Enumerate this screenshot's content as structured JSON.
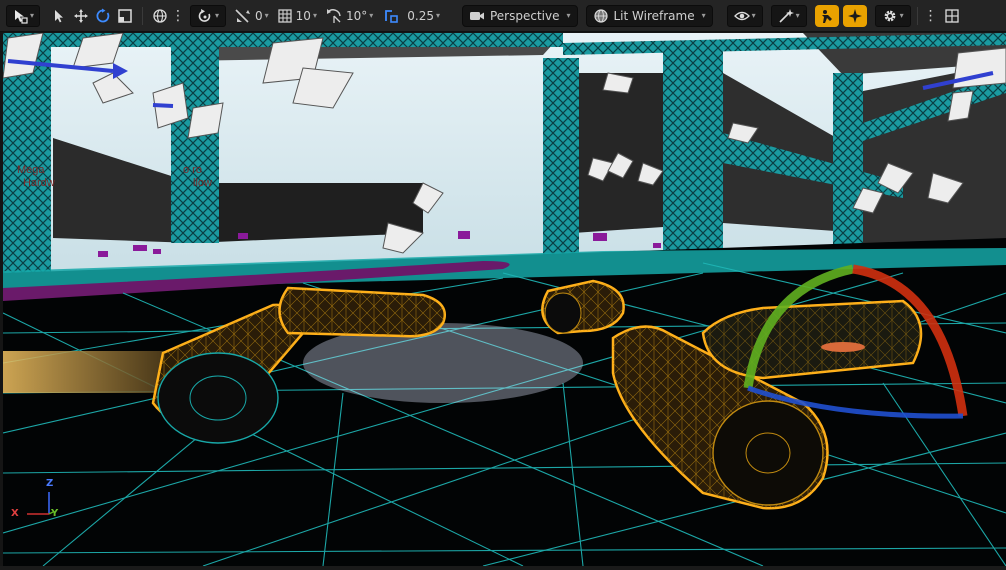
{
  "toolbar": {
    "translate_snap_value": "0",
    "grid_snap_value": "10",
    "rotate_snap_value": "10°",
    "scale_snap_value": "0.25",
    "view_mode_label": "Perspective",
    "view_lighting_label": "Lit Wireframe"
  },
  "icons": [
    "select-mode-icon",
    "arrow-cursor-icon",
    "move-icon",
    "rotate-icon",
    "scale-icon",
    "globe-icon",
    "kebab-icon",
    "transform-toggle-icon",
    "surface-snap-icon",
    "grid-snap-icon",
    "rotate-snap-icon",
    "scale-snap-icon",
    "camera-icon",
    "lighting-icon",
    "eye-icon",
    "realtime-icon",
    "cinematic-icon",
    "sparkle-icon",
    "gear-icon",
    "layout-icon"
  ],
  "colors": {
    "toolbar_bg": "#242424",
    "accent_gold": "#e9a200",
    "snap_blue": "#3d8bff",
    "wireframe_cyan": "#1fb8b8",
    "selection_orange": "#ffb01a",
    "gizmo_red": "#d03010",
    "gizmo_green": "#60b020",
    "gizmo_blue": "#2050d0"
  },
  "viewport": {
    "axis_gizmo": {
      "z_label": "Z",
      "x_label": "X",
      "y_label": "Y"
    },
    "scene_text_left": [
      "Mega",
      "Hardw"
    ],
    "scene_text_mid": [
      "o ro",
      "llow"
    ]
  }
}
